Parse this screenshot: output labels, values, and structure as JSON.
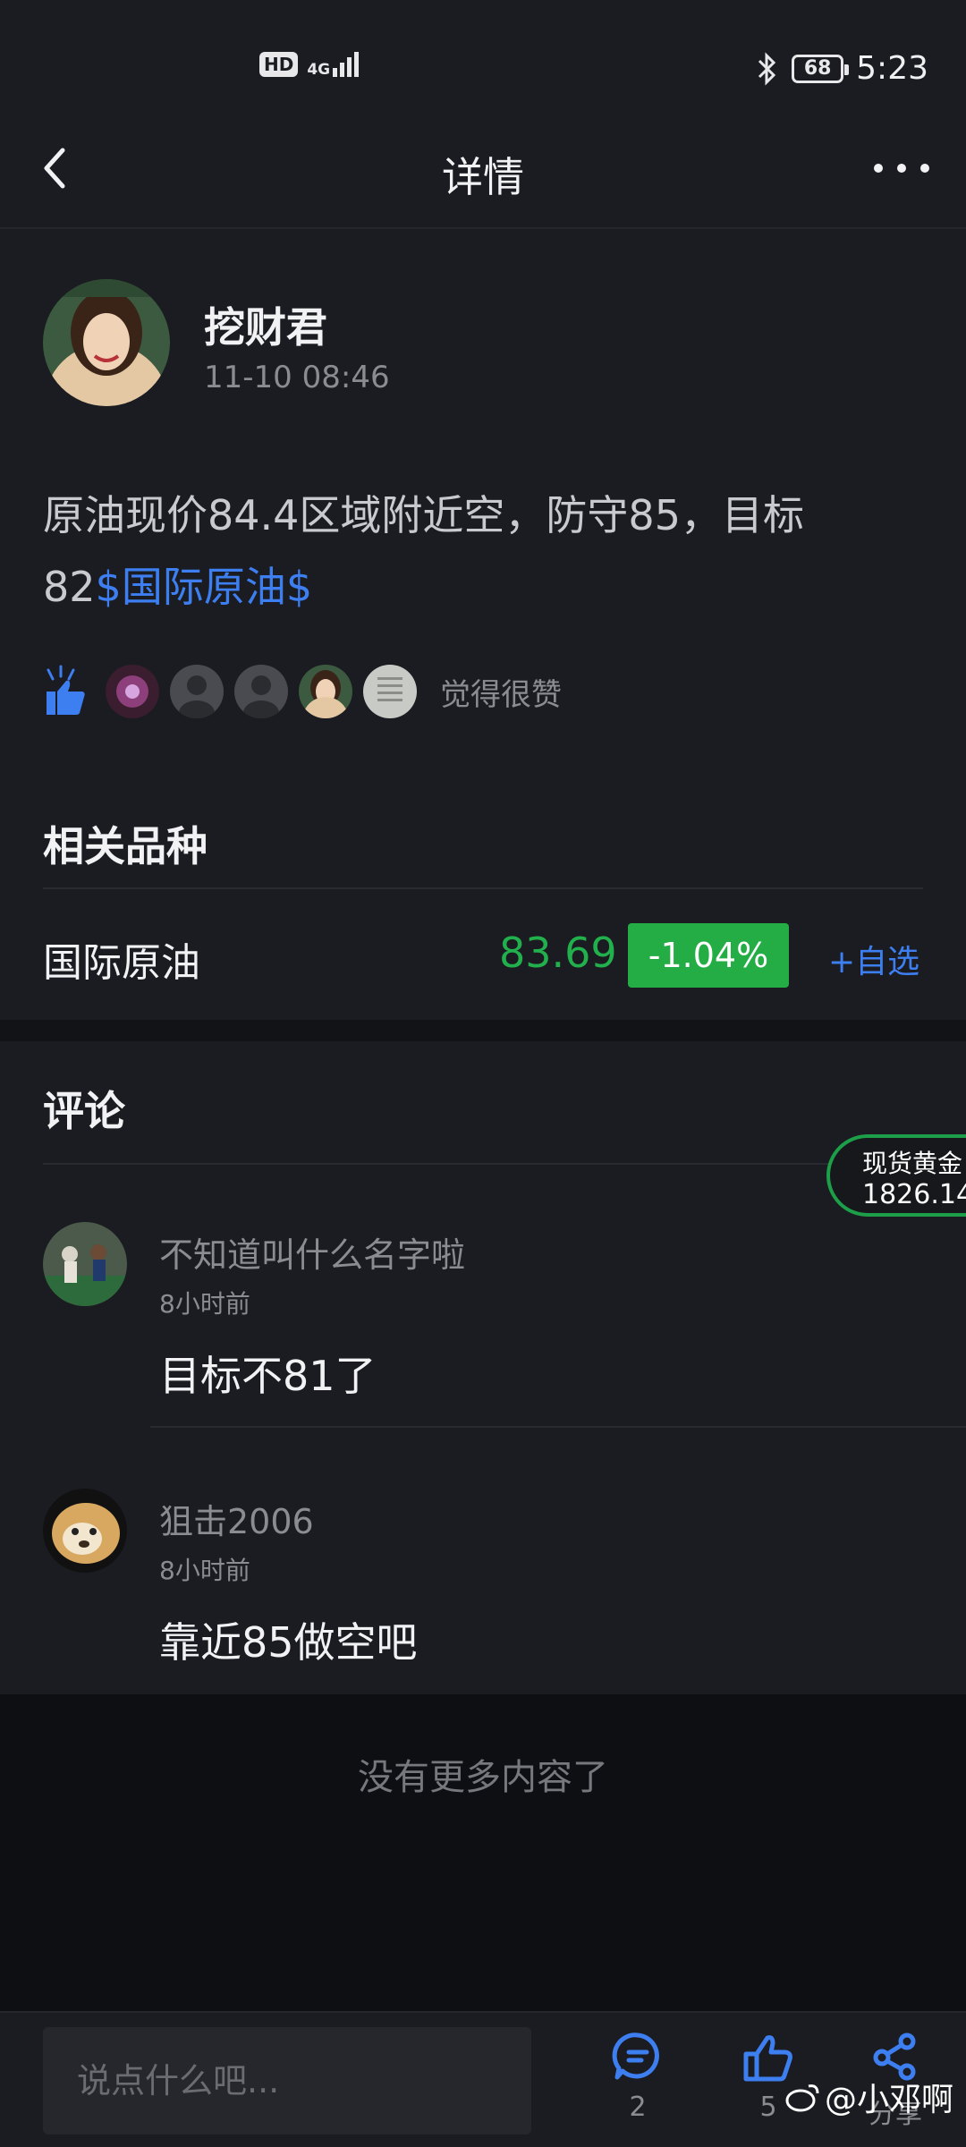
{
  "status_bar": {
    "hd": "HD",
    "network": "4G",
    "battery": "68",
    "time": "5:23"
  },
  "header": {
    "title": "详情"
  },
  "post": {
    "author": "挖财君",
    "time": "11-10 08:46",
    "text_prefix": "原油现价84.4区域附近空，防守85，目标82",
    "text_tag": "$国际原油$",
    "likes_label": "觉得很赞"
  },
  "related": {
    "title": "相关品种",
    "instrument_name": "国际原油",
    "price": "83.69",
    "change": "-1.04%",
    "watch_label": "+自选",
    "colors": {
      "down": "#22b04d",
      "link": "#3d7ff0"
    }
  },
  "comments": {
    "title": "评论",
    "items": [
      {
        "user": "不知道叫什么名字啦",
        "time": "8小时前",
        "text": "目标不81了"
      },
      {
        "user": "狙击2006",
        "time": "8小时前",
        "text": "靠近85做空吧"
      }
    ],
    "no_more": "没有更多内容了"
  },
  "floating_quote": {
    "name": "现货黄金",
    "price": "1826.14"
  },
  "bottom_bar": {
    "input_placeholder": "说点什么吧...",
    "comment_count": "2",
    "like_count": "5",
    "share_label": "分享"
  },
  "watermark": "@小邓啊"
}
